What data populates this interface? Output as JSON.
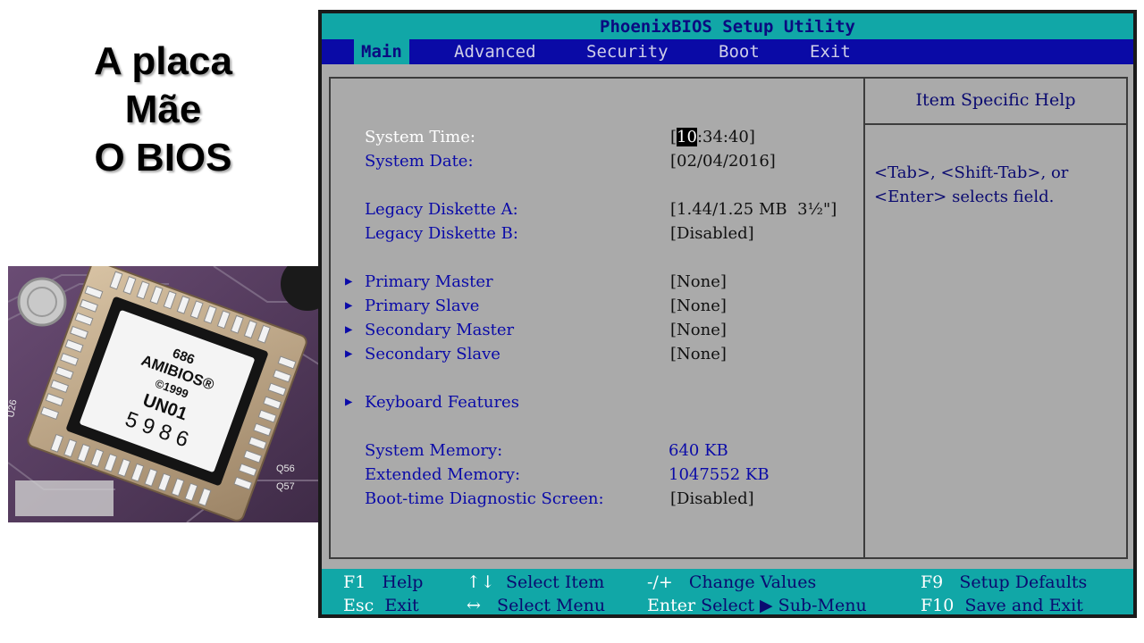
{
  "slide": {
    "title_lines": [
      "A placa",
      "Mãe",
      "O BIOS"
    ]
  },
  "chip_photo": {
    "chip_lines": [
      "686",
      "AMIBIOS®",
      "©1999",
      "UN01",
      "5 9 8 6"
    ],
    "board_markings": [
      "U26",
      "Q56",
      "Q57"
    ]
  },
  "bios": {
    "title": "PhoenixBIOS Setup Utility",
    "tabs": [
      "Main",
      "Advanced",
      "Security",
      "Boot",
      "Exit"
    ],
    "active_tab": "Main",
    "rows": {
      "system_time": {
        "label": "System Time:",
        "value_open": "[",
        "value_hl": "10",
        "value_rest": ":34:40]"
      },
      "system_date": {
        "label": "System Date:",
        "value": "[02/04/2016]"
      },
      "diskette_a": {
        "label": "Legacy Diskette A:",
        "value": "[1.44/1.25 MB  3½\"]"
      },
      "diskette_b": {
        "label": "Legacy Diskette B:",
        "value": "[Disabled]"
      },
      "primary_master": {
        "label": "Primary Master",
        "value": "[None]"
      },
      "primary_slave": {
        "label": "Primary Slave",
        "value": "[None]"
      },
      "secondary_master": {
        "label": "Secondary Master",
        "value": "[None]"
      },
      "secondary_slave": {
        "label": "Secondary Slave",
        "value": "[None]"
      },
      "keyboard_features": {
        "label": "Keyboard Features"
      },
      "system_memory": {
        "label": "System Memory:",
        "value": "640 KB"
      },
      "extended_memory": {
        "label": "Extended Memory:",
        "value": "1047552 KB"
      },
      "boot_diag": {
        "label": "Boot-time Diagnostic Screen:",
        "value": "[Disabled]"
      }
    },
    "help": {
      "title": "Item Specific Help",
      "text": "<Tab>, <Shift-Tab>, or\n<Enter> selects field."
    },
    "footer": {
      "f1": {
        "key": "F1",
        "desc": "Help"
      },
      "esc": {
        "key": "Esc",
        "desc": "Exit"
      },
      "updown": {
        "key": "↑↓",
        "desc": "Select Item"
      },
      "leftright": {
        "key": "↔",
        "desc": "Select Menu"
      },
      "minusplus": {
        "key": "-/+",
        "desc": "Change Values"
      },
      "enter": {
        "key": "Enter",
        "desc": "Select ▶ Sub-Menu"
      },
      "f9": {
        "key": "F9",
        "desc": "Setup Defaults"
      },
      "f10": {
        "key": "F10",
        "desc": "Save and Exit"
      }
    },
    "colors": {
      "cyan": "#11a7a7",
      "menu_blue": "#0a0aa6",
      "body_gray": "#aaaaaa",
      "text_blue": "#0a0aa8"
    }
  }
}
